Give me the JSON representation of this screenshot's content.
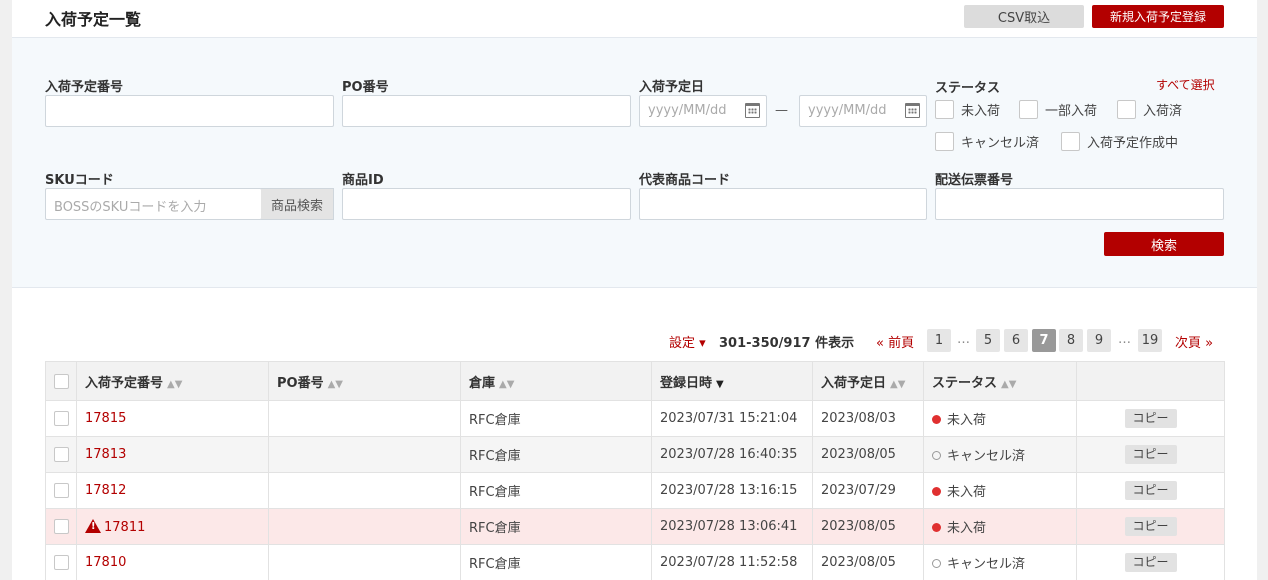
{
  "header": {
    "title": "入荷予定一覧",
    "csv_label": "CSV取込",
    "new_label": "新規入荷予定登録"
  },
  "filter": {
    "arrival_no_label": "入荷予定番号",
    "po_label": "PO番号",
    "date_label": "入荷予定日",
    "date_from_placeholder": "yyyy/MM/dd",
    "date_to_placeholder": "yyyy/MM/dd",
    "date_separator": "—",
    "status_label": "ステータス",
    "select_all": "すべて選択",
    "statuses": [
      "未入荷",
      "一部入荷",
      "入荷済",
      "キャンセル済",
      "入荷予定作成中"
    ],
    "sku_label": "SKUコード",
    "sku_placeholder": "BOSSのSKUコードを入力",
    "sku_search": "商品検索",
    "product_id_label": "商品ID",
    "rep_code_label": "代表商品コード",
    "tracking_label": "配送伝票番号",
    "search_label": "検索"
  },
  "pager": {
    "settings": "設定 ▾",
    "count": "301-350/917 件表示",
    "prev": "« 前頁",
    "next": "次頁 »",
    "pages": [
      "1",
      "5",
      "6",
      "7",
      "8",
      "9",
      "19"
    ],
    "ellipsis": "…"
  },
  "table": {
    "headers": [
      "入荷予定番号",
      "PO番号",
      "倉庫",
      "登録日時",
      "入荷予定日",
      "ステータス"
    ],
    "copy_label": "コピー",
    "rows": [
      {
        "id": "17815",
        "po": "",
        "warehouse": "RFC倉庫",
        "registered": "2023/07/31 15:21:04",
        "arrival": "2023/08/03",
        "status": "未入荷"
      },
      {
        "id": "17813",
        "po": "",
        "warehouse": "RFC倉庫",
        "registered": "2023/07/28 16:40:35",
        "arrival": "2023/08/05",
        "status": "キャンセル済"
      },
      {
        "id": "17812",
        "po": "",
        "warehouse": "RFC倉庫",
        "registered": "2023/07/28 13:16:15",
        "arrival": "2023/07/29",
        "status": "未入荷"
      },
      {
        "id": "17811",
        "po": "",
        "warehouse": "RFC倉庫",
        "registered": "2023/07/28 13:06:41",
        "arrival": "2023/08/05",
        "status": "未入荷"
      },
      {
        "id": "17810",
        "po": "",
        "warehouse": "RFC倉庫",
        "registered": "2023/07/28 11:52:58",
        "arrival": "2023/08/05",
        "status": "キャンセル済"
      }
    ]
  },
  "colors": {
    "accent": "#b30000",
    "status_red": "#e03030",
    "warn_row": "#fce8e8"
  }
}
